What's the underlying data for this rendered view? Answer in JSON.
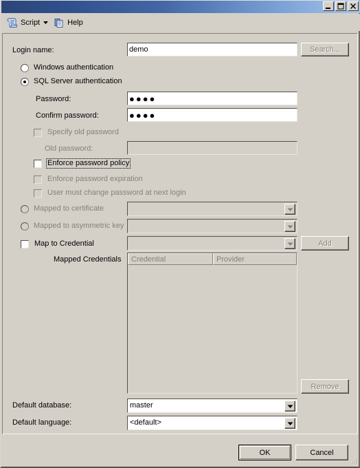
{
  "window": {
    "titlebar_buttons": [
      {
        "name": "minimize",
        "glyph": "minimize-icon"
      },
      {
        "name": "maximize",
        "glyph": "maximize-icon"
      },
      {
        "name": "close",
        "glyph": "close-icon"
      }
    ],
    "accent_start": "#2b4579",
    "accent_end": "#a8c4e8",
    "face_color": "#d4d0c8",
    "disabled_text_color": "#868078"
  },
  "toolbar": {
    "script_label": "Script",
    "script_icon": "script-scroll-icon",
    "script_caret": "chevron-down-icon",
    "help_label": "Help",
    "help_icon": "help-pages-icon"
  },
  "form": {
    "login_name": {
      "label": "Login name:",
      "value": "demo",
      "placeholder": ""
    },
    "search_button": {
      "label": "Search...",
      "enabled": false
    },
    "auth": {
      "windows": {
        "label": "Windows authentication",
        "selected": false
      },
      "sql_server": {
        "label": "SQL Server authentication",
        "selected": true
      }
    },
    "password": {
      "label": "Password:",
      "value": "●●●●",
      "enabled": true
    },
    "confirm_password": {
      "label": "Confirm password:",
      "value": "●●●●",
      "enabled": true
    },
    "specify_old_password": {
      "label": "Specify old password",
      "checked": false,
      "enabled": false
    },
    "old_password": {
      "label": "Old password:",
      "value": "",
      "enabled": false
    },
    "enforce_password_policy": {
      "label": "Enforce password policy",
      "checked": false,
      "enabled": true,
      "focused": true
    },
    "enforce_password_expiration": {
      "label": "Enforce password expiration",
      "checked": false,
      "enabled": false
    },
    "user_must_change_password": {
      "label": "User must change password at next login",
      "checked": false,
      "enabled": false
    },
    "mapped_to_certificate": {
      "label": "Mapped to certificate",
      "selected": false,
      "value": "",
      "enabled": false
    },
    "mapped_to_asymmetric_key": {
      "label": "Mapped to asymmetric key",
      "selected": false,
      "value": "",
      "enabled": false
    },
    "map_to_credential": {
      "label": "Map to Credential",
      "checked": false,
      "value": "",
      "enabled": false
    },
    "add_button": {
      "label": "Add",
      "enabled": false
    },
    "mapped_credentials": {
      "label": "Mapped Credentials",
      "columns": [
        "Credential",
        "Provider"
      ],
      "rows": []
    },
    "remove_button": {
      "label": "Remove",
      "enabled": false
    },
    "default_database": {
      "label": "Default database:",
      "value": "master",
      "enabled": true
    },
    "default_language": {
      "label": "Default language:",
      "value": "<default>",
      "enabled": true
    }
  },
  "footer": {
    "ok_label": "OK",
    "cancel_label": "Cancel",
    "resize_grip": "resize-grip-icon"
  }
}
